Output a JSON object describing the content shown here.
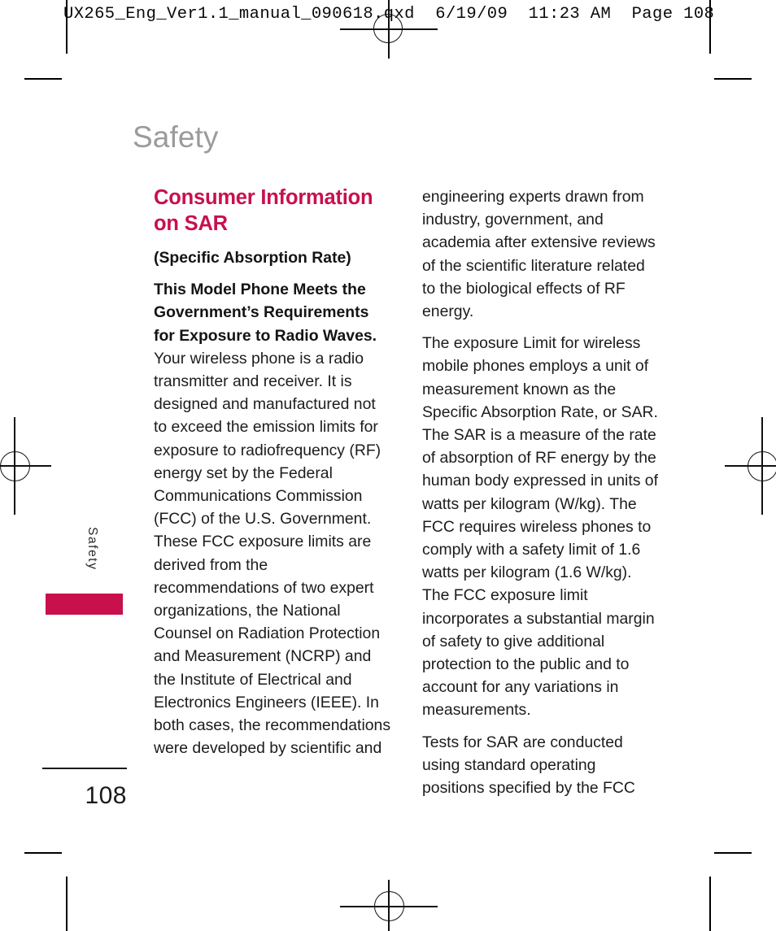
{
  "prepress": {
    "header_line": "UX265_Eng_Ver1.1_manual_090618.qxd  6/19/09  11:23 AM  Page 108"
  },
  "page": {
    "title": "Safety",
    "side_tab_label": "Safety",
    "folio": "108",
    "accent_color": "#c8104c",
    "title_color": "#9b9b9b"
  },
  "content": {
    "section_heading": "Consumer Information on SAR",
    "subheading": "(Specific Absorption Rate)",
    "left_column": {
      "para1_bold": "This Model Phone Meets the Government’s Requirements for Exposure to Radio Waves.",
      "para1_rest": " Your wireless phone is a radio transmitter and receiver. It is designed and manufactured not to exceed the emission limits for exposure to radiofrequency (RF) energy set by the Federal Communications Commission (FCC) of the U.S. Government. These FCC exposure limits are derived from the recommendations of two expert organizations, the National Counsel on Radiation Protection and Measurement (NCRP) and the Institute of Electrical and Electronics Engineers (IEEE). In both cases, the recommendations were developed by scientific and"
    },
    "right_column": {
      "para1": "engineering experts drawn from industry, government, and academia after extensive reviews of the scientific literature related to the biological effects of RF energy.",
      "para2": "The exposure Limit for wireless mobile phones employs a unit of measurement known as the Specific Absorption Rate, or SAR. The SAR is a measure of the rate of absorption of RF energy by the human body expressed in units of watts per kilogram (W/kg). The FCC requires wireless phones to comply with a safety limit of 1.6 watts per kilogram (1.6 W/kg). The FCC exposure limit incorporates a substantial margin of safety to give additional protection to the public and to account for any variations in measurements.",
      "para3": "Tests for SAR are conducted using standard operating positions specified by the FCC"
    }
  }
}
